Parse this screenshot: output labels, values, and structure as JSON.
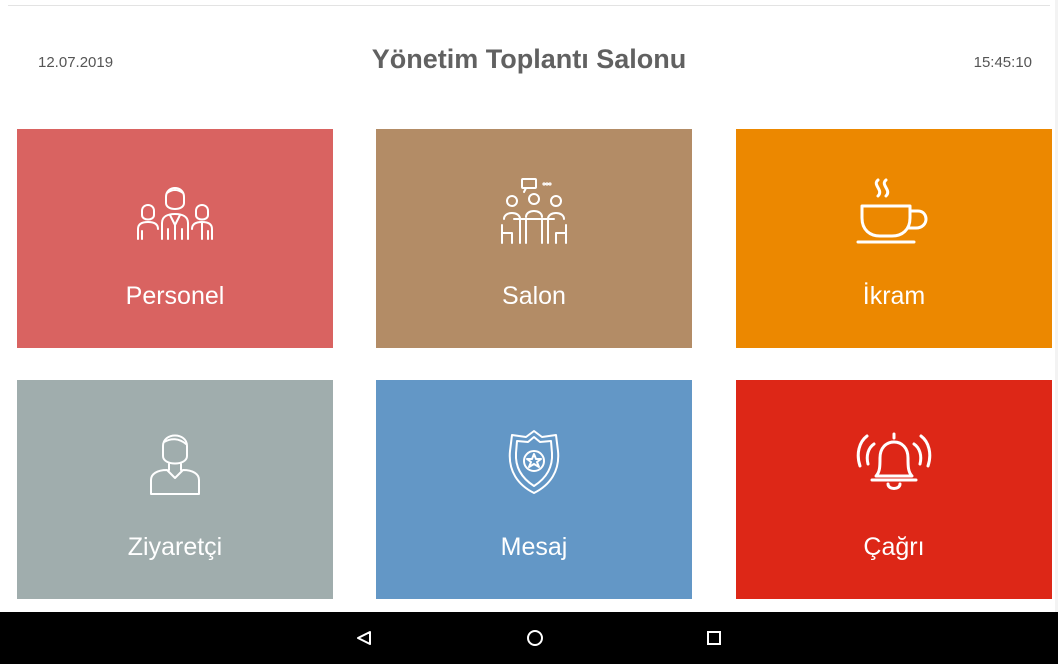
{
  "header": {
    "date": "12.07.2019",
    "title": "Yönetim Toplantı Salonu",
    "time": "15:45:10"
  },
  "tiles": [
    {
      "label": "Personel",
      "icon": "people-group-icon",
      "color": "#D96361"
    },
    {
      "label": "Salon",
      "icon": "meeting-room-icon",
      "color": "#B38C66"
    },
    {
      "label": "İkram",
      "icon": "coffee-cup-icon",
      "color": "#EC8800"
    },
    {
      "label": "Ziyaretçi",
      "icon": "visitor-person-icon",
      "color": "#A0ADAD"
    },
    {
      "label": "Mesaj",
      "icon": "badge-shield-icon",
      "color": "#6397C6"
    },
    {
      "label": "Çağrı",
      "icon": "ringing-bell-icon",
      "color": "#DD2717"
    }
  ],
  "navbar": {
    "buttons": [
      "back-icon",
      "home-icon",
      "recents-icon"
    ],
    "color": "#000000"
  }
}
